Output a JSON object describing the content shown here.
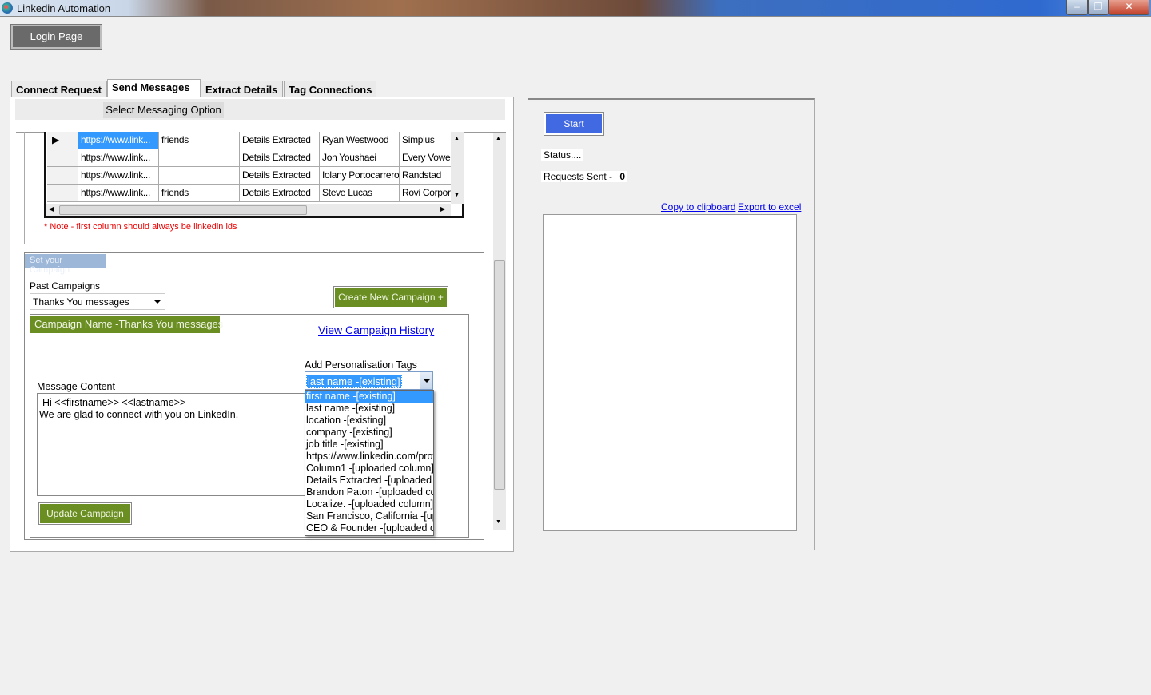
{
  "window": {
    "title": "Linkedin Automation",
    "controls": [
      "minimize",
      "restore",
      "close"
    ]
  },
  "login_button": "Login Page",
  "tabs": [
    {
      "label": "Connect Request"
    },
    {
      "label": "Send Messages",
      "selected": true
    },
    {
      "label": "Extract Details"
    },
    {
      "label": "Tag Connections"
    }
  ],
  "messaging_option": "Select Messaging Option",
  "grid": {
    "rows": [
      [
        "https://www.link...",
        "friends",
        "Details Extracted",
        "Ryan Westwood",
        "Simplus"
      ],
      [
        "https://www.link...",
        "",
        "Details Extracted",
        "Jon Youshaei",
        "Every Vowel"
      ],
      [
        "https://www.link...",
        "",
        "Details Extracted",
        "Iolany Portocarrero",
        "Randstad"
      ],
      [
        "https://www.link...",
        "friends",
        "Details Extracted",
        "Steve Lucas",
        "Rovi Corpora"
      ]
    ]
  },
  "note": "* Note - first column should always be linkedin ids",
  "campaign": {
    "section_label": "Set your Campaign",
    "past_label": "Past Campaigns",
    "past_value": "Thanks You messages",
    "create_button": "Create New Campaign +",
    "name_header": "Campaign Name -Thanks You messages",
    "history_link": "View Campaign History",
    "tags_label": "Add Personalisation Tags",
    "tags_value": "last name -[existing]",
    "tag_options": [
      "first name -[existing]",
      "last name -[existing]",
      "location -[existing]",
      "company -[existing]",
      "job title -[existing]",
      "https://www.linkedin.com/prof",
      "Column1 -[uploaded column]",
      "Details Extracted -[uploaded c",
      "Brandon Paton -[uploaded co",
      "Localize. -[uploaded column]",
      "San Francisco, California -[up",
      "CEO & Founder -[uploaded co"
    ],
    "message_label": "Message Content",
    "message_line1": "Hi <<firstname>> <<lastname>>",
    "message_line2": "We are glad to connect with you on LinkedIn.",
    "update_button": "Update Campaign"
  },
  "status_panel": {
    "start_button": "Start",
    "status": "Status....",
    "requests_label": "Requests Sent -",
    "requests_value": "0",
    "copy_link": "Copy to clipboard",
    "export_link": "Export to excel"
  },
  "colors": {
    "green": "#6b8e23",
    "start_blue": "#4169e1",
    "selection": "#3399ff"
  }
}
